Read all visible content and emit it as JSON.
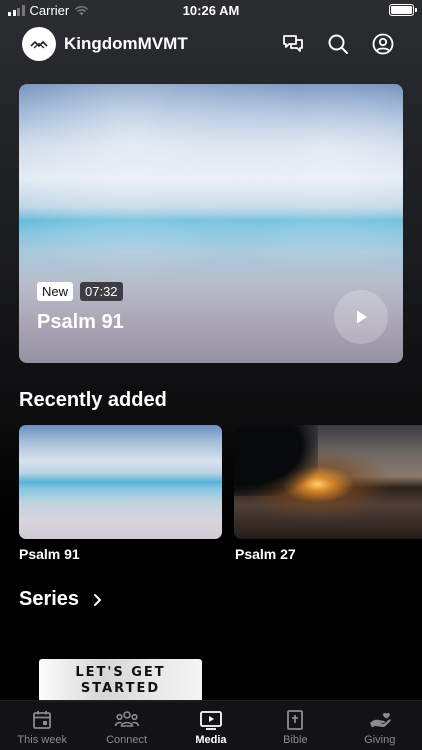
{
  "status_bar": {
    "carrier": "Carrier",
    "time": "10:26 AM"
  },
  "header": {
    "title": "KingdomMVMT",
    "icons": [
      "chat-icon",
      "search-icon",
      "profile-icon"
    ]
  },
  "hero": {
    "badge": "New",
    "duration": "07:32",
    "title": "Psalm 91"
  },
  "recently_added": {
    "title": "Recently added",
    "items": [
      {
        "title": "Psalm 91"
      },
      {
        "title": "Psalm 27"
      }
    ]
  },
  "series": {
    "title": "Series"
  },
  "banner": {
    "line1": "LET'S GET",
    "line2": "STARTED"
  },
  "tabs": [
    {
      "label": "This week",
      "icon": "calendar-icon"
    },
    {
      "label": "Connect",
      "icon": "people-icon"
    },
    {
      "label": "Media",
      "icon": "play-icon",
      "active": true
    },
    {
      "label": "Bible",
      "icon": "bible-icon"
    },
    {
      "label": "Giving",
      "icon": "giving-hand-icon"
    }
  ],
  "colors": {
    "background": "#000000",
    "tab_inactive": "#8b8b90",
    "tab_active": "#ffffff"
  }
}
